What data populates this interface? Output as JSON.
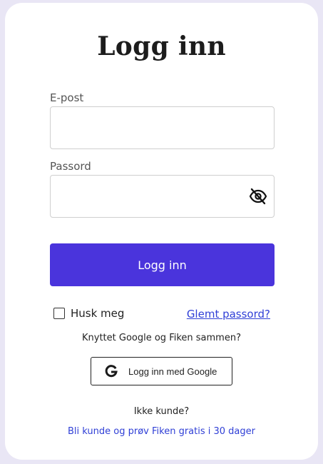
{
  "page": {
    "title": "Logg inn"
  },
  "form": {
    "email_label": "E-post",
    "email_value": "",
    "password_label": "Passord",
    "password_value": "",
    "submit_label": "Logg inn",
    "remember_label": "Husk meg",
    "remember_checked": false,
    "forgot_label": "Glemt passord?"
  },
  "google": {
    "prompt": "Knyttet Google og Fiken sammen?",
    "button_label": "Logg inn med Google",
    "icon": "google-g-icon"
  },
  "signup": {
    "prompt": "Ikke kunde?",
    "link_label": "Bli kunde og prøv Fiken gratis i 30 dager"
  },
  "icons": {
    "password_toggle": "eye-slash-icon"
  },
  "colors": {
    "background": "#e9e6f5",
    "card": "#ffffff",
    "primary": "#4a34dc",
    "link": "#2f3fd6",
    "text": "#1c1c1c"
  }
}
